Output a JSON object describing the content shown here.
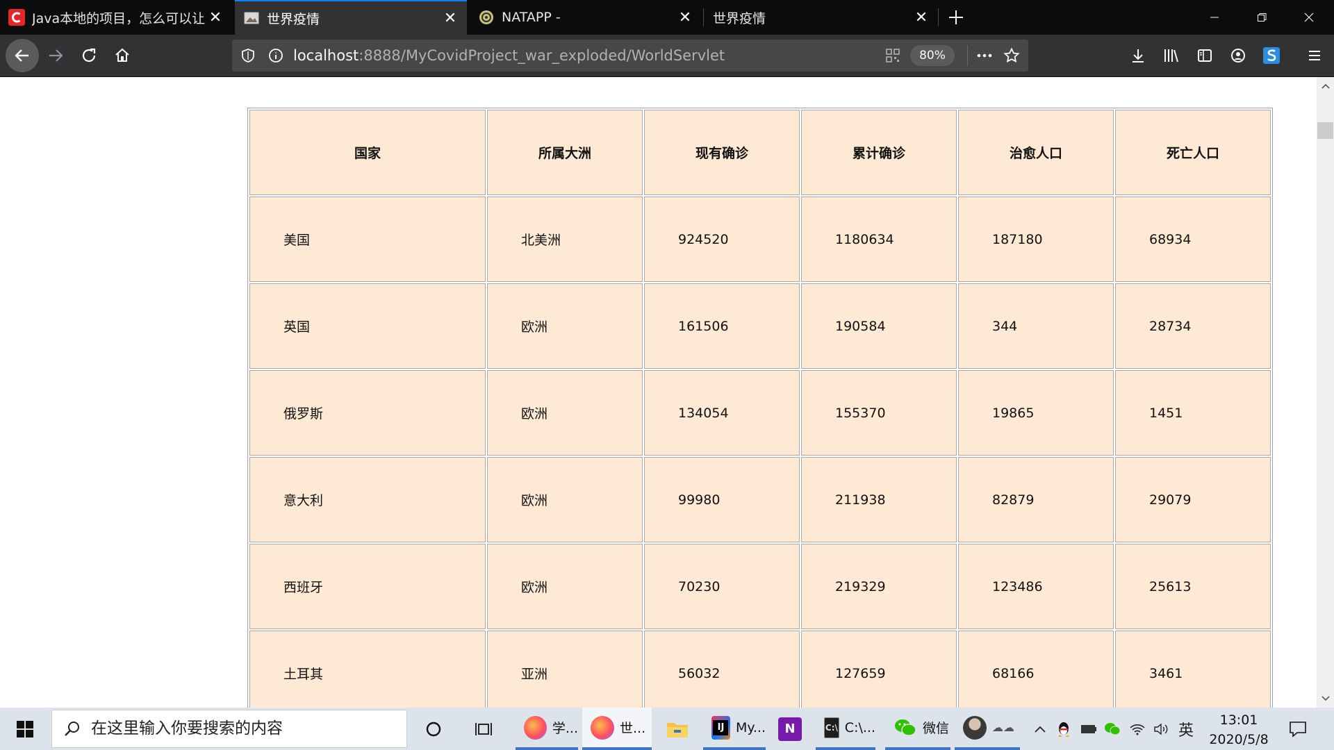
{
  "browser": {
    "tabs": [
      {
        "title": "Java本地的项目，怎么可以让别",
        "favicon": "csdn-favicon",
        "active": false
      },
      {
        "title": "世界疫情",
        "favicon": "page-favicon",
        "active": true
      },
      {
        "title": "NATAPP -",
        "favicon": "natapp-favicon",
        "active": false
      },
      {
        "title": "世界疫情",
        "favicon": "none",
        "active": false
      }
    ],
    "url": {
      "host": "localhost",
      "rest": ":8888/MyCovidProject_war_exploded/WorldServlet"
    },
    "zoom": "80%"
  },
  "table": {
    "headers": [
      "国家",
      "所属大洲",
      "现有确诊",
      "累计确诊",
      "治愈人口",
      "死亡人口"
    ],
    "rows": [
      [
        "美国",
        "北美洲",
        "924520",
        "1180634",
        "187180",
        "68934"
      ],
      [
        "英国",
        "欧洲",
        "161506",
        "190584",
        "344",
        "28734"
      ],
      [
        "俄罗斯",
        "欧洲",
        "134054",
        "155370",
        "19865",
        "1451"
      ],
      [
        "意大利",
        "欧洲",
        "99980",
        "211938",
        "82879",
        "29079"
      ],
      [
        "西班牙",
        "欧洲",
        "70230",
        "219329",
        "123486",
        "25613"
      ],
      [
        "土耳其",
        "亚洲",
        "56032",
        "127659",
        "68166",
        "3461"
      ]
    ]
  },
  "taskbar": {
    "search_placeholder": "在这里输入你要搜索的内容",
    "apps": [
      {
        "label": "学...",
        "icon": "firefox-icon"
      },
      {
        "label": "世...",
        "icon": "firefox-icon"
      },
      {
        "label": "",
        "icon": "file-explorer-icon"
      },
      {
        "label": "My...",
        "icon": "intellij-icon"
      },
      {
        "label": "",
        "icon": "onenote-icon"
      },
      {
        "label": "C:\\...",
        "icon": "cmd-icon"
      },
      {
        "label": "微信",
        "icon": "wechat-icon"
      },
      {
        "label": "",
        "icon": "user-app-icon"
      }
    ],
    "ime": "英",
    "clock": {
      "time": "13:01",
      "date": "2020/5/8"
    }
  },
  "colors": {
    "cell_bg": "#fde9d4",
    "tab_accent": "#0a84ff"
  }
}
